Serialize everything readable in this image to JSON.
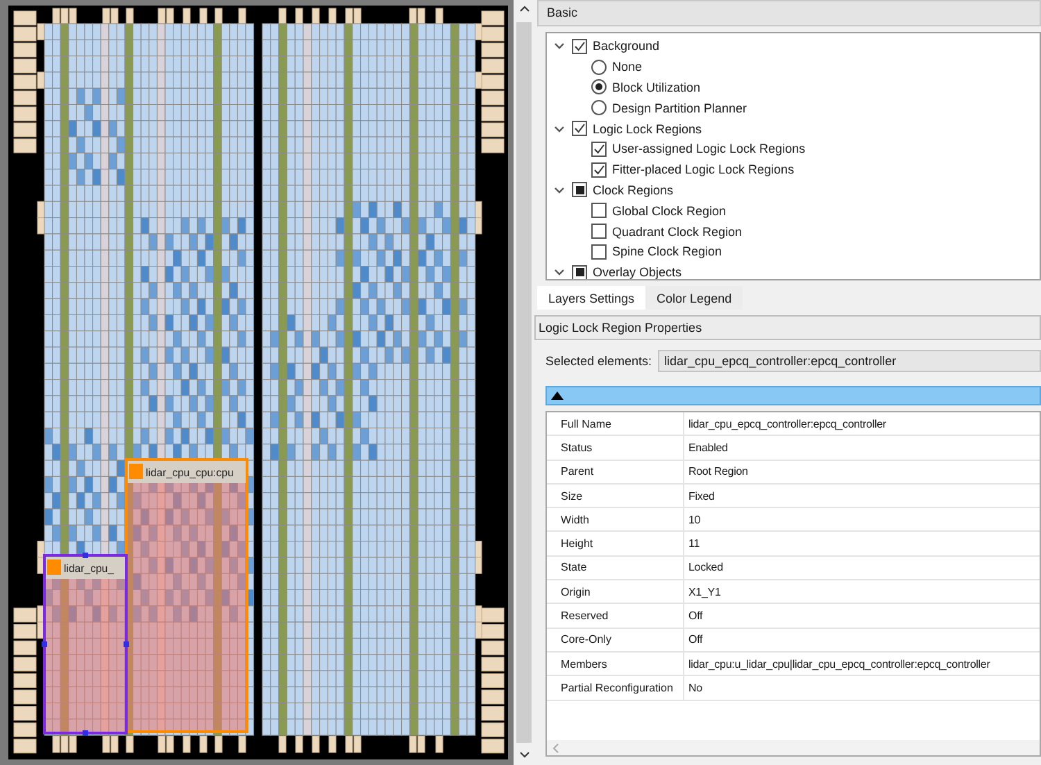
{
  "floorplan": {
    "regions": [
      {
        "label": "lidar_cpu_cpu:cpu",
        "color": "#ff8c00",
        "selected": false
      },
      {
        "label": "lidar_cpu_",
        "color": "#7a2be0",
        "selected": true
      }
    ]
  },
  "basic_header": "Basic",
  "layer_tree": [
    {
      "kind": "checkbox",
      "label": "Background",
      "checked": true,
      "expanded": true,
      "children": [
        {
          "kind": "radio",
          "label": "None",
          "selected": false
        },
        {
          "kind": "radio",
          "label": "Block Utilization",
          "selected": true
        },
        {
          "kind": "radio",
          "label": "Design Partition Planner",
          "selected": false
        }
      ]
    },
    {
      "kind": "checkbox",
      "label": "Logic Lock Regions",
      "checked": true,
      "expanded": true,
      "children": [
        {
          "kind": "checkbox",
          "label": "User-assigned Logic Lock Regions",
          "checked": true
        },
        {
          "kind": "checkbox",
          "label": "Fitter-placed Logic Lock Regions",
          "checked": true
        }
      ]
    },
    {
      "kind": "checkbox",
      "label": "Clock Regions",
      "partial": true,
      "expanded": true,
      "children": [
        {
          "kind": "checkbox",
          "label": "Global Clock Region",
          "checked": false
        },
        {
          "kind": "checkbox",
          "label": "Quadrant Clock Region",
          "checked": false
        },
        {
          "kind": "checkbox",
          "label": "Spine Clock Region",
          "checked": false
        }
      ]
    },
    {
      "kind": "checkbox",
      "label": "Overlay Objects",
      "partial": true,
      "expanded": true
    }
  ],
  "tabs": [
    {
      "label": "Layers Settings",
      "selected": true
    },
    {
      "label": "Color Legend",
      "selected": false
    }
  ],
  "properties_header": "Logic Lock Region Properties",
  "selected_elements": {
    "label": "Selected elements:",
    "value": "lidar_cpu_epcq_controller:epcq_controller"
  },
  "properties": [
    {
      "name": "Full Name",
      "value": "lidar_cpu_epcq_controller:epcq_controller"
    },
    {
      "name": "Status",
      "value": "Enabled"
    },
    {
      "name": "Parent",
      "value": "Root Region"
    },
    {
      "name": "Size",
      "value": "Fixed"
    },
    {
      "name": "Width",
      "value": "10"
    },
    {
      "name": "Height",
      "value": "11"
    },
    {
      "name": "State",
      "value": "Locked"
    },
    {
      "name": "Origin",
      "value": "X1_Y1"
    },
    {
      "name": "Reserved",
      "value": "Off"
    },
    {
      "name": "Core-Only",
      "value": "Off"
    },
    {
      "name": "Members",
      "value": "lidar_cpu:u_lidar_cpu|lidar_cpu_epcq_controller:epcq_controller"
    },
    {
      "name": "Partial Reconfiguration",
      "value": "No"
    }
  ]
}
